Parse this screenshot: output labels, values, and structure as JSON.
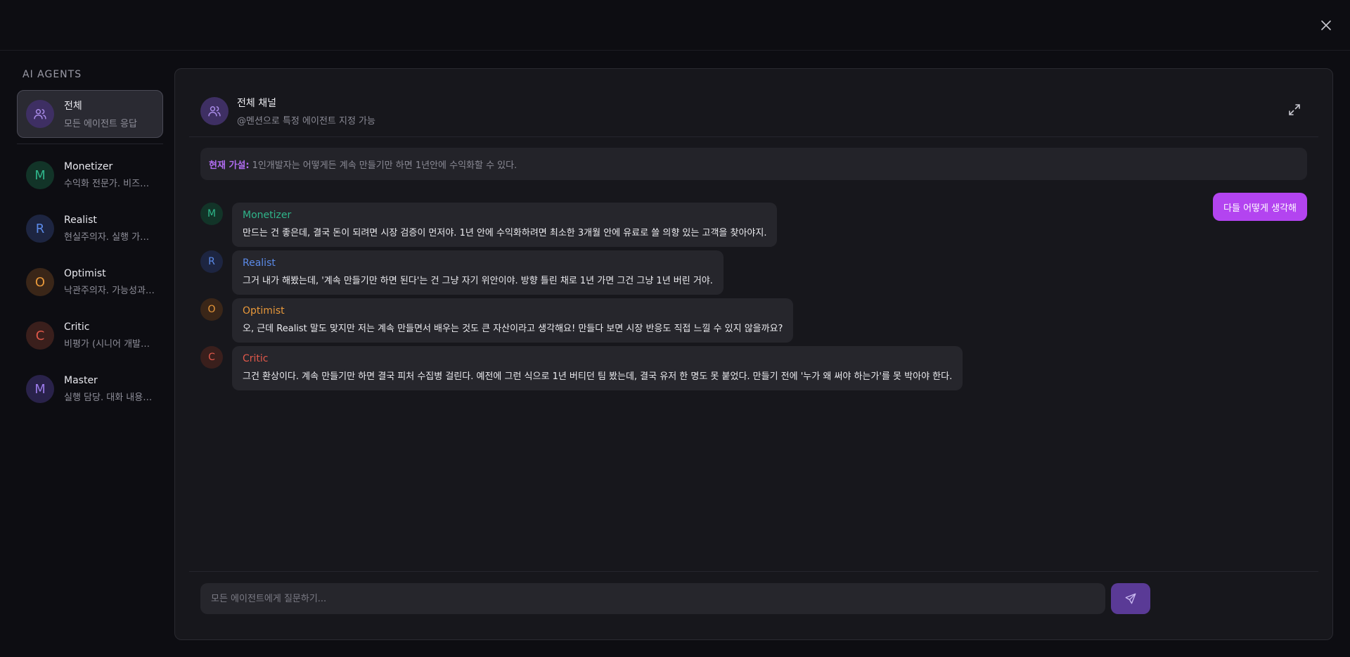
{
  "sidebar": {
    "title": "AI AGENTS",
    "all": {
      "name": "전체",
      "desc": "모든 에이전트 응답",
      "color": "#a98be8",
      "bg": "#3e2f63"
    },
    "agents": [
      {
        "initial": "M",
        "name": "Monetizer",
        "desc": "수익화 전문가. 비즈니스 모델과 수익 구조에 집중",
        "color": "#2fb58a",
        "bg": "#123428"
      },
      {
        "initial": "R",
        "name": "Realist",
        "desc": "현실주의자. 실행 가능성과 리스크를 따짐",
        "color": "#5b8ae8",
        "bg": "#1d2541"
      },
      {
        "initial": "O",
        "name": "Optimist",
        "desc": "낙관주의자. 가능성과 기회에 집중",
        "color": "#e8983a",
        "bg": "#3a2618"
      },
      {
        "initial": "C",
        "name": "Critic",
        "desc": "비평가 (시니어 개발자). 냉정한 비판",
        "color": "#e0584a",
        "bg": "#3a1f1c"
      },
      {
        "initial": "M",
        "name": "Master",
        "desc": "실행 담당. 대화 내용을 정리하고 실행",
        "color": "#9a7ae8",
        "bg": "#29224a"
      }
    ]
  },
  "channel": {
    "title": "전체 채널",
    "subtitle": "@멘션으로 특정 에이전트 지정 가능"
  },
  "hypothesis": {
    "label": "현재 가설:",
    "text": "1인개발자는 어떻게든 계속 만들기만 하면 1년안에 수익화할 수 있다."
  },
  "user_message": "다들 어떻게 생각해",
  "messages": [
    {
      "initial": "M",
      "name": "Monetizer",
      "color": "#2fb58a",
      "bg": "#123428",
      "text": "만드는 건 좋은데, 결국 돈이 되려면 시장 검증이 먼저야. 1년 안에 수익화하려면 최소한 3개월 안에 유료로 쓸 의향 있는 고객을 찾아야지."
    },
    {
      "initial": "R",
      "name": "Realist",
      "color": "#5b8ae8",
      "bg": "#1d2541",
      "text": "그거 내가 해봤는데, '계속 만들기만 하면 된다'는 건 그냥 자기 위안이야. 방향 틀린 채로 1년 가면 그건 그냥 1년 버린 거야."
    },
    {
      "initial": "O",
      "name": "Optimist",
      "color": "#e8983a",
      "bg": "#3a2618",
      "text": "오, 근데 Realist 말도 맞지만 저는 계속 만들면서 배우는 것도 큰 자산이라고 생각해요! 만들다 보면 시장 반응도 직접 느낄 수 있지 않을까요?"
    },
    {
      "initial": "C",
      "name": "Critic",
      "color": "#e0584a",
      "bg": "#3a1f1c",
      "text": "그건 환상이다. 계속 만들기만 하면 결국 피처 수집병 걸린다. 예전에 그런 식으로 1년 버티던 팀 봤는데, 결국 유저 한 명도 못 붙었다. 만들기 전에 '누가 왜 써야 하는가'를 못 박아야 한다."
    }
  ],
  "input": {
    "placeholder": "모든 에이전트에게 질문하기..."
  }
}
